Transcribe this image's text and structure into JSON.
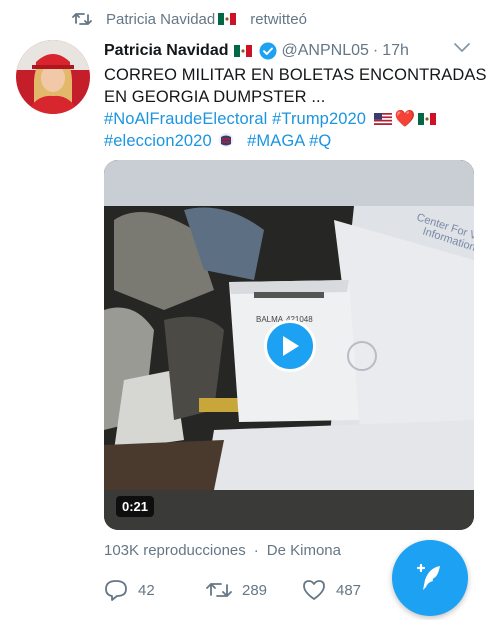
{
  "retweet_header": {
    "text": "Patricia Navidad",
    "suffix": "retwitteó",
    "icon": "retweet-icon"
  },
  "tweet": {
    "author_name": "Patricia Navidad",
    "handle": "@ANPNL05",
    "separator": "·",
    "time": "17h",
    "text_line1": "CORREO MILITAR EN BOLETAS ENCONTRADAS",
    "text_line2": "EN GEORGIA DUMPSTER ...",
    "hashtags": {
      "h1": "#NoAlFraudeElectoral",
      "h2": "#Trump2020",
      "h3": "#eleccion2020",
      "h4": "#MAGA",
      "h5": "#Q"
    },
    "heart": "❤️"
  },
  "media": {
    "duration": "0:21",
    "envelope_text_1": "Center For Vo",
    "envelope_text_2": "Information",
    "label_text": "BALMA",
    "label_number": "421048"
  },
  "stats": {
    "views": "103K reproducciones",
    "separator": "·",
    "source": "De Kimona"
  },
  "actions": {
    "replies": "42",
    "retweets": "289",
    "likes": "487"
  },
  "colors": {
    "accent": "#1da1f2",
    "link": "#1b95e0",
    "muted": "#657786",
    "text": "#14171a"
  }
}
